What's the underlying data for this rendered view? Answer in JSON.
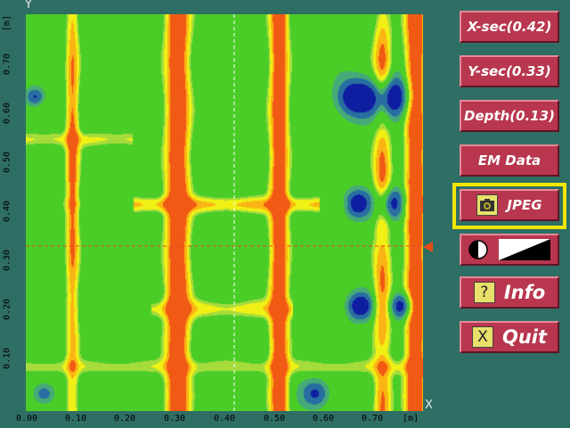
{
  "plot": {
    "y_axis_letter": "Y",
    "x_axis_letter": "X",
    "x_ticks": [
      "0.00",
      "0.10",
      "0.20",
      "0.30",
      "0.40",
      "0.50",
      "0.60",
      "0.70",
      "[m]"
    ],
    "y_ticks": [
      "[m]",
      "0.70",
      "0.60",
      "0.50",
      "0.40",
      "0.30",
      "0.20",
      "0.10"
    ],
    "crosshair_x": 0.42,
    "crosshair_y": 0.33
  },
  "buttons": {
    "xsec": "X-sec(0.42)",
    "ysec": "Y-sec(0.33)",
    "depth": "Depth(0.13)",
    "emdata": "EM Data",
    "jpeg": "JPEG",
    "info": "Info",
    "info_icon": "?",
    "quit": "Quit",
    "quit_icon": "X"
  },
  "icons": {
    "jpeg": "camera-icon",
    "contrast": "contrast-icon",
    "palette": "palette-ramp-icon",
    "info": "question-icon",
    "quit": "close-icon"
  },
  "colors": {
    "background": "#2f6e64",
    "button": "#b8374e",
    "highlight": "#f2e600",
    "crosshair": "#e64a19"
  }
}
